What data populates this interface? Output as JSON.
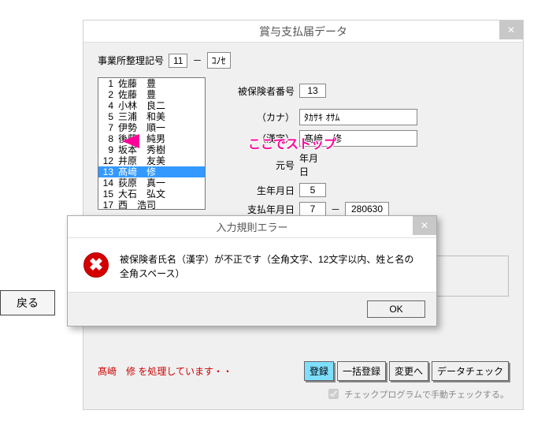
{
  "window": {
    "title": "賞与支払届データ",
    "close": "✕"
  },
  "top": {
    "label": "事業所整理記号",
    "code1": "11",
    "dash": "－",
    "code2": "ｺﾉｾ"
  },
  "list": [
    {
      "n": "1",
      "name": "佐藤　豊"
    },
    {
      "n": "2",
      "name": "佐藤　豊"
    },
    {
      "n": "4",
      "name": "小林　良二"
    },
    {
      "n": "5",
      "name": "三浦　和美"
    },
    {
      "n": "7",
      "name": "伊勢　順一"
    },
    {
      "n": "8",
      "name": "後藤　純男"
    },
    {
      "n": "9",
      "name": "坂本　秀樹"
    },
    {
      "n": "12",
      "name": "井原　友美"
    },
    {
      "n": "13",
      "name": "髙﨑　修"
    },
    {
      "n": "14",
      "name": "荻原　真一"
    },
    {
      "n": "15",
      "name": "大石　弘文"
    },
    {
      "n": "17",
      "name": "西　浩司"
    }
  ],
  "form": {
    "insured_no_label": "被保険者番号",
    "insured_no": "13",
    "kana_label": "（カナ）",
    "kana_value": "ﾀｶｻｷ ｵｻﾑ",
    "kanji_label": "（漢字）",
    "kanji_value": "髙﨑　修",
    "era_label": "元号",
    "era_sub": "年月日",
    "birth_label": "生年月日",
    "birth_code": "5",
    "pay_label": "支払年月日",
    "pay_code": "7",
    "pay_dash": "－",
    "pay_val": "280630"
  },
  "annotation": "ここでストップ",
  "error": {
    "title": "入力規則エラー",
    "message": "被保険者氏名（漢字）が不正です（全角文字、12文字以内、姓と名の全角スペース）",
    "ok": "OK",
    "close": "✕"
  },
  "back": "戻る",
  "status": "髙﨑　修 を処理しています・・",
  "buttons": {
    "register": "登録",
    "bulk": "一括登録",
    "change": "変更へ",
    "check": "データチェック"
  },
  "checkbox": "チェックプログラムで手動チェックする。"
}
